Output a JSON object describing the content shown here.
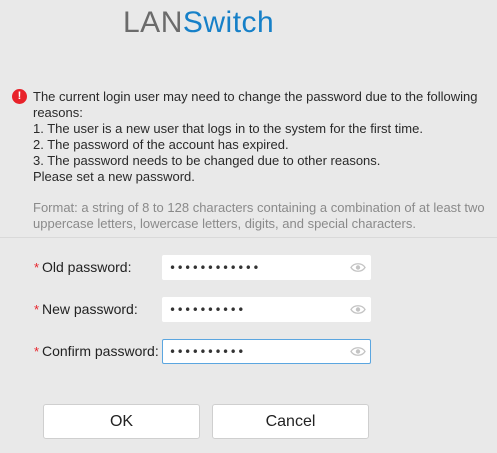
{
  "logo": {
    "part1": "LAN",
    "part2": "Switch"
  },
  "notice": {
    "icon": "exclamation-icon",
    "intro": "The current login user may need to change the password due to the following reasons:",
    "reasons": [
      "1. The user is a new user that logs in to the system for the first time.",
      "2. The password of the account has expired.",
      "3. The password needs to be changed due to other reasons."
    ],
    "closing": "Please set a new password."
  },
  "format_hint": "Format: a string of 8 to 128 characters containing a combination of at least two uppercase letters, lowercase letters, digits, and special characters.",
  "form": {
    "required_mark": "*",
    "old_password": {
      "label": "Old password:",
      "value": "••••••••••••"
    },
    "new_password": {
      "label": "New password:",
      "value": "••••••••••"
    },
    "confirm_password": {
      "label": "Confirm password:",
      "value": "••••••••••"
    }
  },
  "buttons": {
    "ok": "OK",
    "cancel": "Cancel"
  },
  "colors": {
    "brand_blue": "#1680c8",
    "logo_gray": "#6b6b6b",
    "warning_red": "#e8222a",
    "focus_border": "#5ba6e0"
  }
}
